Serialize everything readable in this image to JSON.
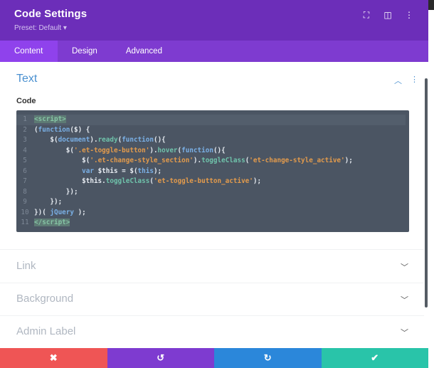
{
  "header": {
    "title": "Code Settings",
    "preset": "Preset: Default ▾",
    "icons": [
      "fullscreen-icon",
      "sidebar-layout-icon",
      "more-vertical-icon"
    ],
    "bg": "#6c2eb9"
  },
  "tabs": [
    {
      "label": "Content",
      "active": true
    },
    {
      "label": "Design"
    },
    {
      "label": "Advanced"
    }
  ],
  "text_section": {
    "title": "Text",
    "code_label": "Code"
  },
  "code_lines": [
    [
      [
        "tag",
        "<script>"
      ]
    ],
    [
      [
        "pl",
        "("
      ],
      [
        "kw",
        "function"
      ],
      [
        "pl",
        "($) {"
      ]
    ],
    [
      [
        "pl",
        "    $("
      ],
      [
        "kw",
        "document"
      ],
      [
        "pl",
        ")."
      ],
      [
        "fn",
        "ready"
      ],
      [
        "pl",
        "("
      ],
      [
        "kw",
        "function"
      ],
      [
        "pl",
        "(){"
      ]
    ],
    [
      [
        "pl",
        "        $("
      ],
      [
        "str",
        "'.et-toggle-button'"
      ],
      [
        "pl",
        ")."
      ],
      [
        "fn",
        "hover"
      ],
      [
        "pl",
        "("
      ],
      [
        "kw",
        "function"
      ],
      [
        "pl",
        "(){"
      ]
    ],
    [
      [
        "pl",
        "            $("
      ],
      [
        "str",
        "'.et-change-style_section'"
      ],
      [
        "pl",
        ")."
      ],
      [
        "fn",
        "toggleClass"
      ],
      [
        "pl",
        "("
      ],
      [
        "str",
        "'et-change-style_active'"
      ],
      [
        "pl",
        ");"
      ]
    ],
    [
      [
        "pl",
        "            "
      ],
      [
        "kw",
        "var"
      ],
      [
        "pl",
        " $this = $("
      ],
      [
        "kw",
        "this"
      ],
      [
        "pl",
        ");"
      ]
    ],
    [
      [
        "pl",
        "            $this."
      ],
      [
        "fn",
        "toggleClass"
      ],
      [
        "pl",
        "("
      ],
      [
        "str",
        "'et-toggle-button_active'"
      ],
      [
        "pl",
        ");"
      ]
    ],
    [
      [
        "pl",
        "        });"
      ]
    ],
    [
      [
        "pl",
        "    });"
      ]
    ],
    [
      [
        "pl",
        "})( "
      ],
      [
        "kw",
        "jQuery"
      ],
      [
        "pl",
        " );"
      ]
    ],
    [
      [
        "tag",
        "</script>"
      ]
    ]
  ],
  "sections": [
    "Link",
    "Background",
    "Admin Label"
  ],
  "footer": [
    {
      "icon": "close-icon",
      "glyph": "✖",
      "color": "#ef5555"
    },
    {
      "icon": "undo-icon",
      "glyph": "↺",
      "color": "#7e3bd0"
    },
    {
      "icon": "redo-icon",
      "glyph": "↻",
      "color": "#2b87da"
    },
    {
      "icon": "check-icon",
      "glyph": "✔",
      "color": "#29c4a9"
    }
  ]
}
